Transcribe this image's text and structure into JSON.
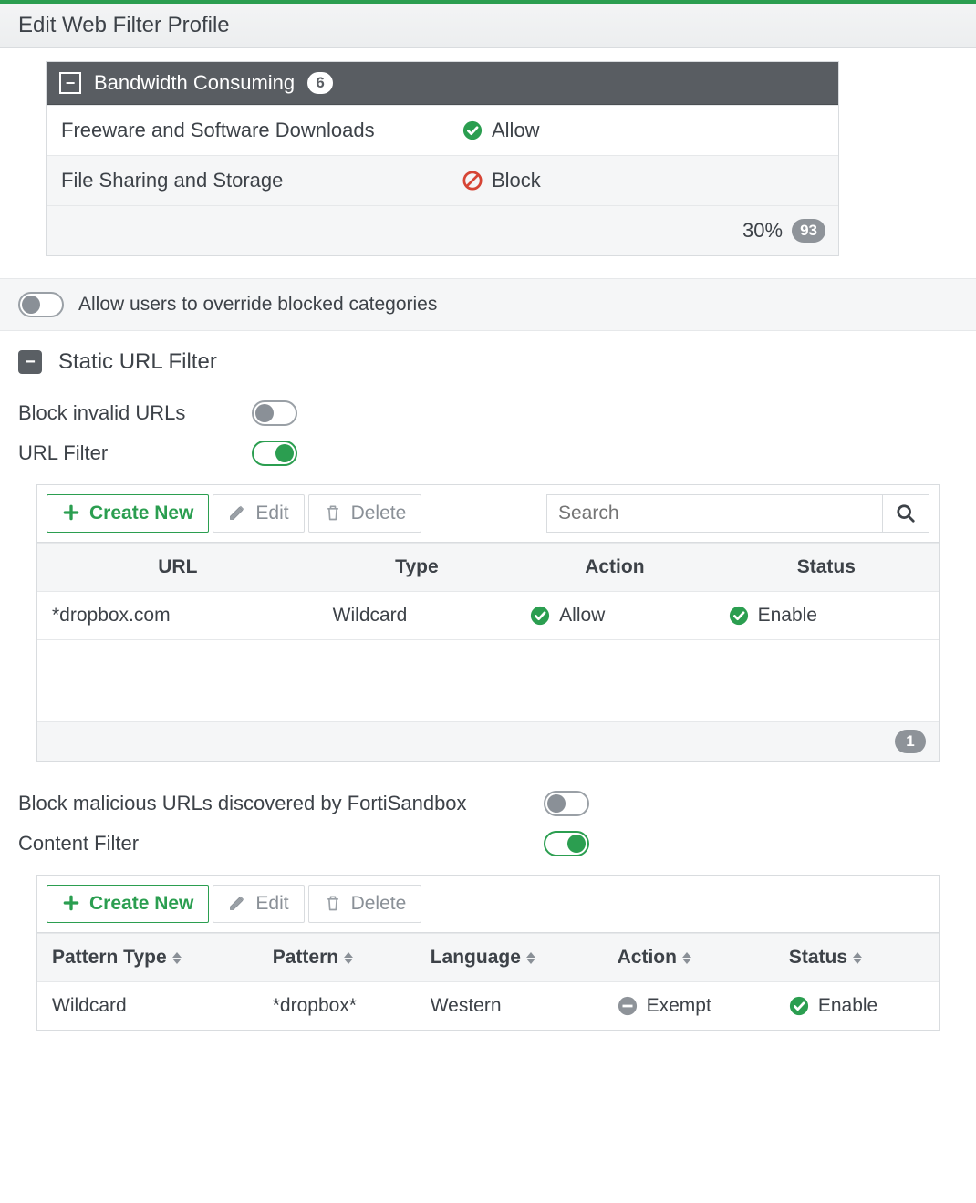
{
  "title": "Edit Web Filter Profile",
  "category": {
    "name": "Bandwidth Consuming",
    "count": 6,
    "rows": [
      {
        "name": "Freeware and Software Downloads",
        "action": "Allow",
        "action_icon": "allow"
      },
      {
        "name": "File Sharing and Storage",
        "action": "Block",
        "action_icon": "block"
      }
    ],
    "percent": "30%",
    "percent_badge": 93
  },
  "override": {
    "label": "Allow users to override blocked categories",
    "on": false
  },
  "section_static": {
    "title": "Static URL Filter"
  },
  "opt_invalid": {
    "label": "Block invalid URLs",
    "on": false
  },
  "opt_urlfilter": {
    "label": "URL Filter",
    "on": true
  },
  "toolbar": {
    "create": "Create New",
    "edit": "Edit",
    "delete": "Delete",
    "search_placeholder": "Search"
  },
  "url_table": {
    "headers": {
      "url": "URL",
      "type": "Type",
      "action": "Action",
      "status": "Status"
    },
    "rows": [
      {
        "url": "*dropbox.com",
        "type": "Wildcard",
        "action": "Allow",
        "action_icon": "allow",
        "status": "Enable",
        "status_icon": "allow"
      }
    ],
    "count": 1
  },
  "opt_sandbox": {
    "label": "Block malicious URLs discovered by FortiSandbox",
    "on": false
  },
  "opt_content": {
    "label": "Content Filter",
    "on": true
  },
  "content_table": {
    "headers": {
      "ptype": "Pattern Type",
      "pattern": "Pattern",
      "lang": "Language",
      "action": "Action",
      "status": "Status"
    },
    "rows": [
      {
        "ptype": "Wildcard",
        "pattern": "*dropbox*",
        "lang": "Western",
        "action": "Exempt",
        "action_icon": "exempt",
        "status": "Enable",
        "status_icon": "allow"
      }
    ]
  }
}
